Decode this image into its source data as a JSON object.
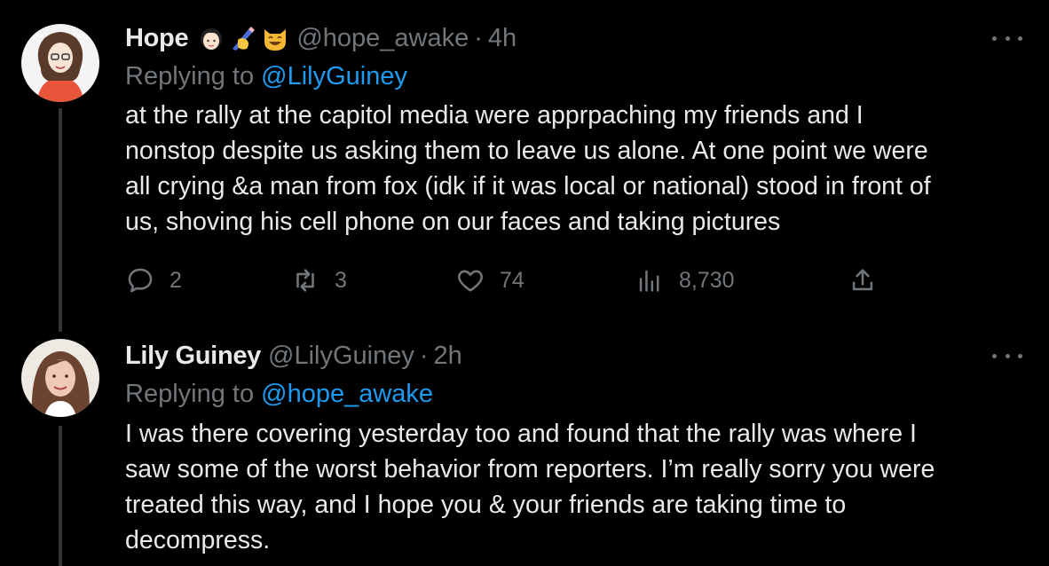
{
  "tweets": [
    {
      "display_name": "Hope",
      "emojis": [
        "woman-face-icon",
        "writing-hand-icon",
        "smiling-cat-icon"
      ],
      "handle": "@hope_awake",
      "separator": "·",
      "time": "4h",
      "replying_prefix": "Replying to",
      "replying_to": "@LilyGuiney",
      "text_lines": [
        "at the rally at the capitol media were apprpaching my friends and I",
        "nonstop despite us asking them to leave us alone. At one point we were",
        "all crying &a man from fox (idk if it was local or national) stood in front of",
        "us, shoving his cell phone on our faces and taking pictures"
      ],
      "actions": {
        "replies": "2",
        "retweets": "3",
        "likes": "74",
        "views": "8,730"
      }
    },
    {
      "display_name": "Lily Guiney",
      "handle": "@LilyGuiney",
      "separator": "·",
      "time": "2h",
      "replying_prefix": "Replying to",
      "replying_to": "@hope_awake",
      "text_lines": [
        "I was there covering yesterday too and found that the rally was where I",
        "saw some of the worst behavior from reporters. I’m really sorry you were",
        "treated this way, and I hope you & your friends are taking time to",
        "decompress."
      ]
    }
  ],
  "colors": {
    "background": "#000000",
    "text": "#e7e9ea",
    "secondary": "#71767b",
    "accent": "#1d9bf0",
    "thread_line": "#333639"
  }
}
